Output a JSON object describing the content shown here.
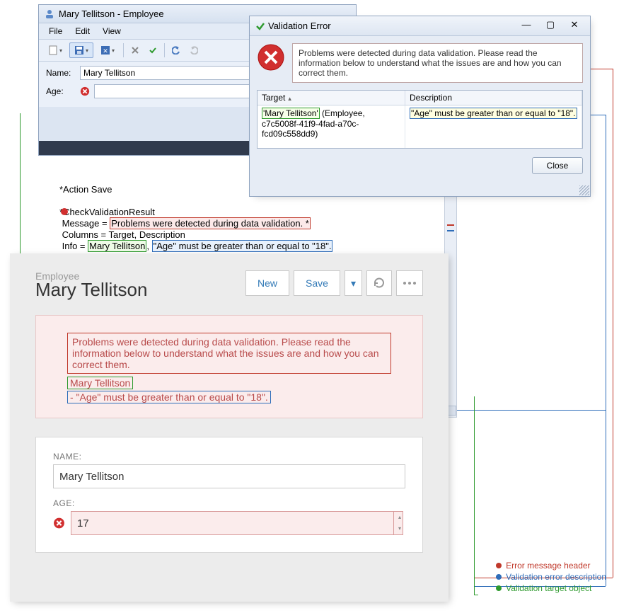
{
  "win1": {
    "title": "Mary Tellitson - Employee",
    "menu": {
      "file": "File",
      "edit": "Edit",
      "view": "View"
    },
    "form": {
      "name_label": "Name:",
      "name_value": "Mary Tellitson",
      "age_label": "Age:",
      "age_value": ""
    },
    "toolbar_icons": [
      "new-doc",
      "save",
      "save-close",
      "close-x",
      "check",
      "undo",
      "redo"
    ]
  },
  "win2": {
    "title": "Validation Error",
    "message": "Problems were detected during data validation. Please read the information below to understand what the issues are and how you can correct them.",
    "grid": {
      "col_target": "Target",
      "col_description": "Description",
      "row": {
        "target_name": "'Mary Tellitson'",
        "target_rest": " (Employee, c7c5008f-41f9-4fad-a70c-fcd09c558dd9)",
        "description": "\"Age\" must be greater than or equal to \"18\"."
      }
    },
    "close_label": "Close"
  },
  "code": {
    "l1": "*Action Save",
    "l2": "*CheckValidationResult",
    "l3_pre": " Message = ",
    "l3_hl": "Problems were detected during data validation. *",
    "l4": " Columns = Target, Description",
    "l5_pre": " Info = ",
    "l5_g": "Mary Tellitson",
    "l5_mid": ", ",
    "l5_b": "\"Age\" must be greater than or equal to \"18\"."
  },
  "web": {
    "subtitle": "Employee",
    "title": "Mary Tellitson",
    "btn_new": "New",
    "btn_save": "Save",
    "err_head": "Problems were detected during data validation. Please read the information below to understand what the issues are and how you can correct them.",
    "err_target": "Mary Tellitson",
    "err_desc": "- \"Age\" must be greater than or equal to \"18\".",
    "name_label": "NAME:",
    "name_value": "Mary Tellitson",
    "age_label": "AGE:",
    "age_value": "17"
  },
  "legend": {
    "red": "Error message header",
    "blue": "Validation error description",
    "green": "Validation target object"
  }
}
